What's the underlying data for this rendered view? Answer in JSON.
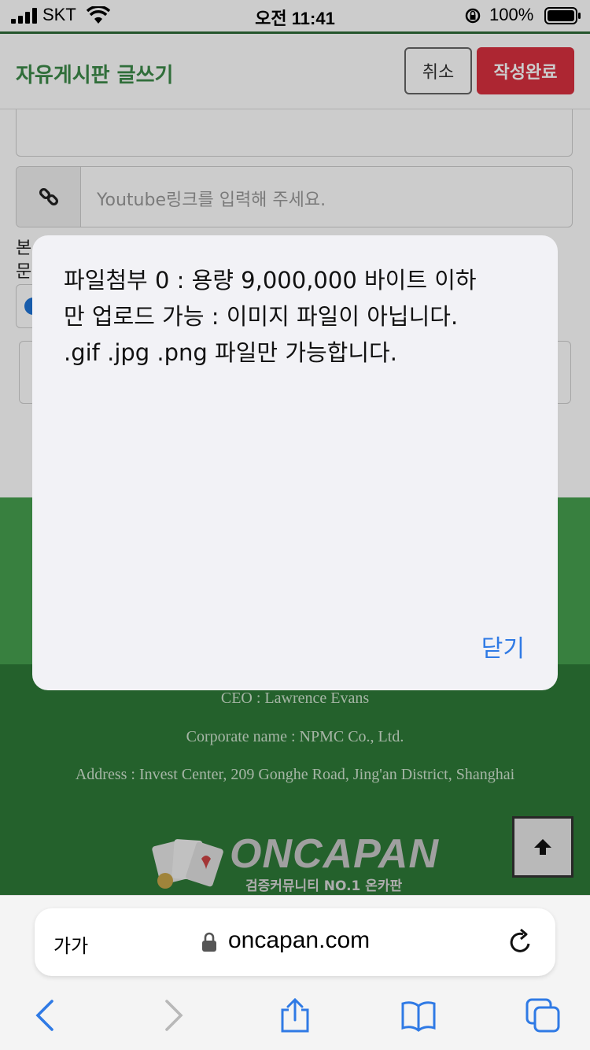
{
  "status_bar": {
    "carrier": "SKT",
    "time": "오전 11:41",
    "battery": "100%"
  },
  "page": {
    "header_title": "자유게시판 글쓰기",
    "cancel_label": "취소",
    "submit_label": "작성완료",
    "youtube_placeholder": "Youtube링크를 입력해 주세요.",
    "body_label": "본문 첨부"
  },
  "footer": {
    "ceo": "CEO : Lawrence Evans",
    "corporate": "Corporate name : NPMC Co., Ltd.",
    "address": "Address : Invest Center, 209 Gonghe Road, Jing'an District, Shanghai",
    "logo_text": "ONCAPAN",
    "logo_tagline": "검증커뮤니티 NO.1 온카판"
  },
  "alert": {
    "message": "파일첨부 0 : 용량 9,000,000 바이트 이하\n만 업로드 가능 : 이미지 파일이 아닙니다.\n.gif .jpg .png 파일만 가능합니다.",
    "close_label": "닫기"
  },
  "browser": {
    "text_size": "가가",
    "url": "oncapan.com"
  },
  "colors": {
    "brand_green": "#46a04f",
    "dark_green": "#2e7a38",
    "submit_red": "#d9303f",
    "ios_blue": "#2f7ae5"
  }
}
